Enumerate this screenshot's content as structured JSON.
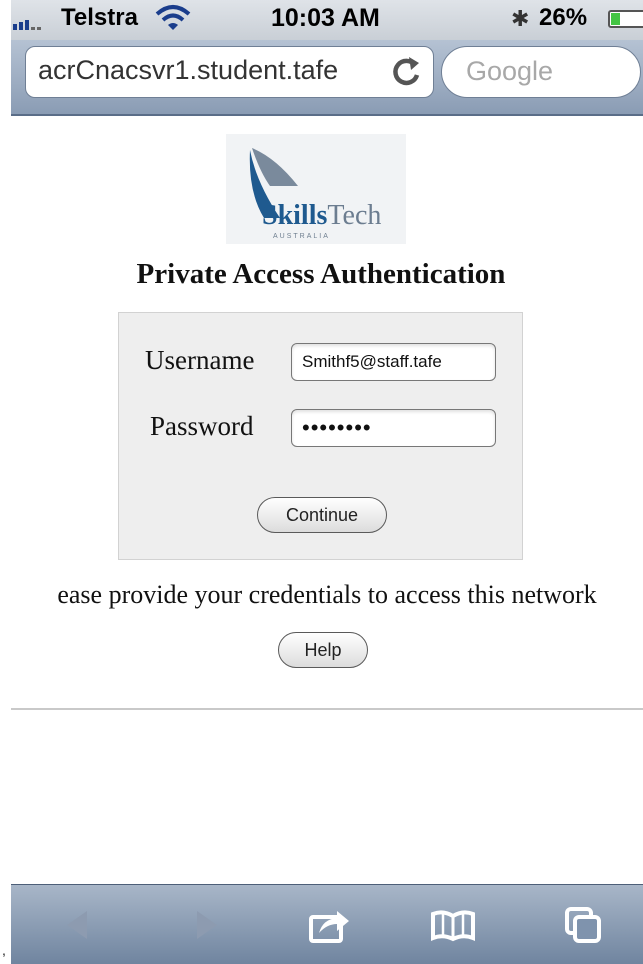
{
  "status_bar": {
    "carrier": "Telstra",
    "time": "10:03 AM",
    "battery_percent": "26%",
    "battery_level": 0.26,
    "icons": [
      "signal-bars",
      "wifi-icon",
      "bluetooth-icon",
      "battery-icon"
    ]
  },
  "browser": {
    "url": "acrCnacsvr1.student.tafe",
    "search_placeholder": "Google",
    "reload_icon": "reload-icon"
  },
  "page": {
    "logo": {
      "name_bold": "Skills",
      "name_regular": "Tech",
      "subtitle": "AUSTRALIA"
    },
    "title": "Private Access Authentication",
    "form": {
      "username_label": "Username",
      "username_value": "Smithf5@staff.tafe",
      "password_label": "Password",
      "password_value": "••••••••",
      "continue_label": "Continue"
    },
    "note": "ease provide your credentials to access this network",
    "help_label": "Help"
  },
  "toolbar": {
    "items": [
      "back-icon",
      "forward-icon",
      "share-icon",
      "bookmarks-icon",
      "tabs-icon"
    ]
  },
  "colors": {
    "accent": "#1f5a8f",
    "toolbar": "#8a9cb4",
    "battery_fill": "#43c543"
  }
}
